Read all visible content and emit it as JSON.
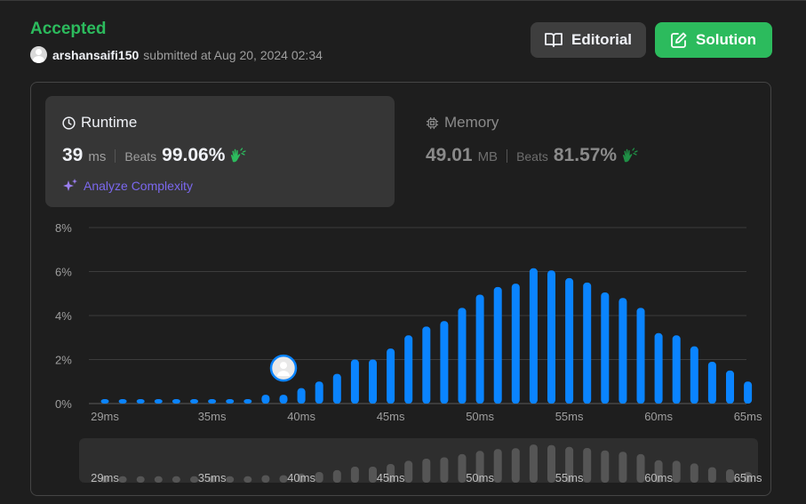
{
  "header": {
    "status": "Accepted",
    "username": "arshansaifi150",
    "submitted_text": "submitted at Aug 20, 2024 02:34"
  },
  "buttons": {
    "editorial": "Editorial",
    "solution": "Solution"
  },
  "runtime": {
    "title": "Runtime",
    "value": "39",
    "unit": "ms",
    "beats_label": "Beats",
    "beats": "99.06%",
    "analyze": "Analyze Complexity"
  },
  "memory": {
    "title": "Memory",
    "value": "49.01",
    "unit": "MB",
    "beats_label": "Beats",
    "beats": "81.57%"
  },
  "colors": {
    "accent_green": "#2cbb5d",
    "bar_blue": "#0a84ff",
    "analyze_purple": "#7b68ee",
    "brush_gray": "#555555"
  },
  "icons": {
    "editorial": "book-icon",
    "solution": "edit-icon",
    "runtime": "clock-icon",
    "memory": "chip-icon",
    "beats": "clap-icon",
    "analyze": "sparkle-icon"
  },
  "chart_data": {
    "type": "bar",
    "ylim": [
      0,
      8
    ],
    "yticks": [
      "0%",
      "2%",
      "4%",
      "6%",
      "8%"
    ],
    "xticks": [
      "29ms",
      "35ms",
      "40ms",
      "45ms",
      "50ms",
      "55ms",
      "60ms",
      "65ms"
    ],
    "highlight": "39ms",
    "brush_ticks": [
      "29ms",
      "35ms",
      "40ms",
      "45ms",
      "50ms",
      "55ms",
      "60ms",
      "65ms"
    ],
    "series": [
      {
        "x": [
          "29ms",
          "30ms",
          "31ms",
          "32ms",
          "33ms",
          "34ms",
          "35ms",
          "36ms",
          "37ms",
          "38ms",
          "39ms",
          "40ms",
          "41ms",
          "42ms",
          "43ms",
          "44ms",
          "45ms",
          "46ms",
          "47ms",
          "48ms",
          "49ms",
          "50ms",
          "51ms",
          "52ms",
          "53ms",
          "54ms",
          "55ms",
          "56ms",
          "57ms",
          "58ms",
          "59ms",
          "60ms",
          "61ms",
          "62ms",
          "63ms",
          "64ms",
          "65ms"
        ],
        "values": [
          0.2,
          0.2,
          0.2,
          0.2,
          0.2,
          0.2,
          0.2,
          0.2,
          0.2,
          0.4,
          0.4,
          0.7,
          1.0,
          1.35,
          2.0,
          2.0,
          2.5,
          3.1,
          3.5,
          3.75,
          4.35,
          4.95,
          5.3,
          5.45,
          6.15,
          6.05,
          5.7,
          5.5,
          5.05,
          4.8,
          4.35,
          3.2,
          3.1,
          2.6,
          1.9,
          1.5,
          1.0
        ]
      }
    ]
  }
}
